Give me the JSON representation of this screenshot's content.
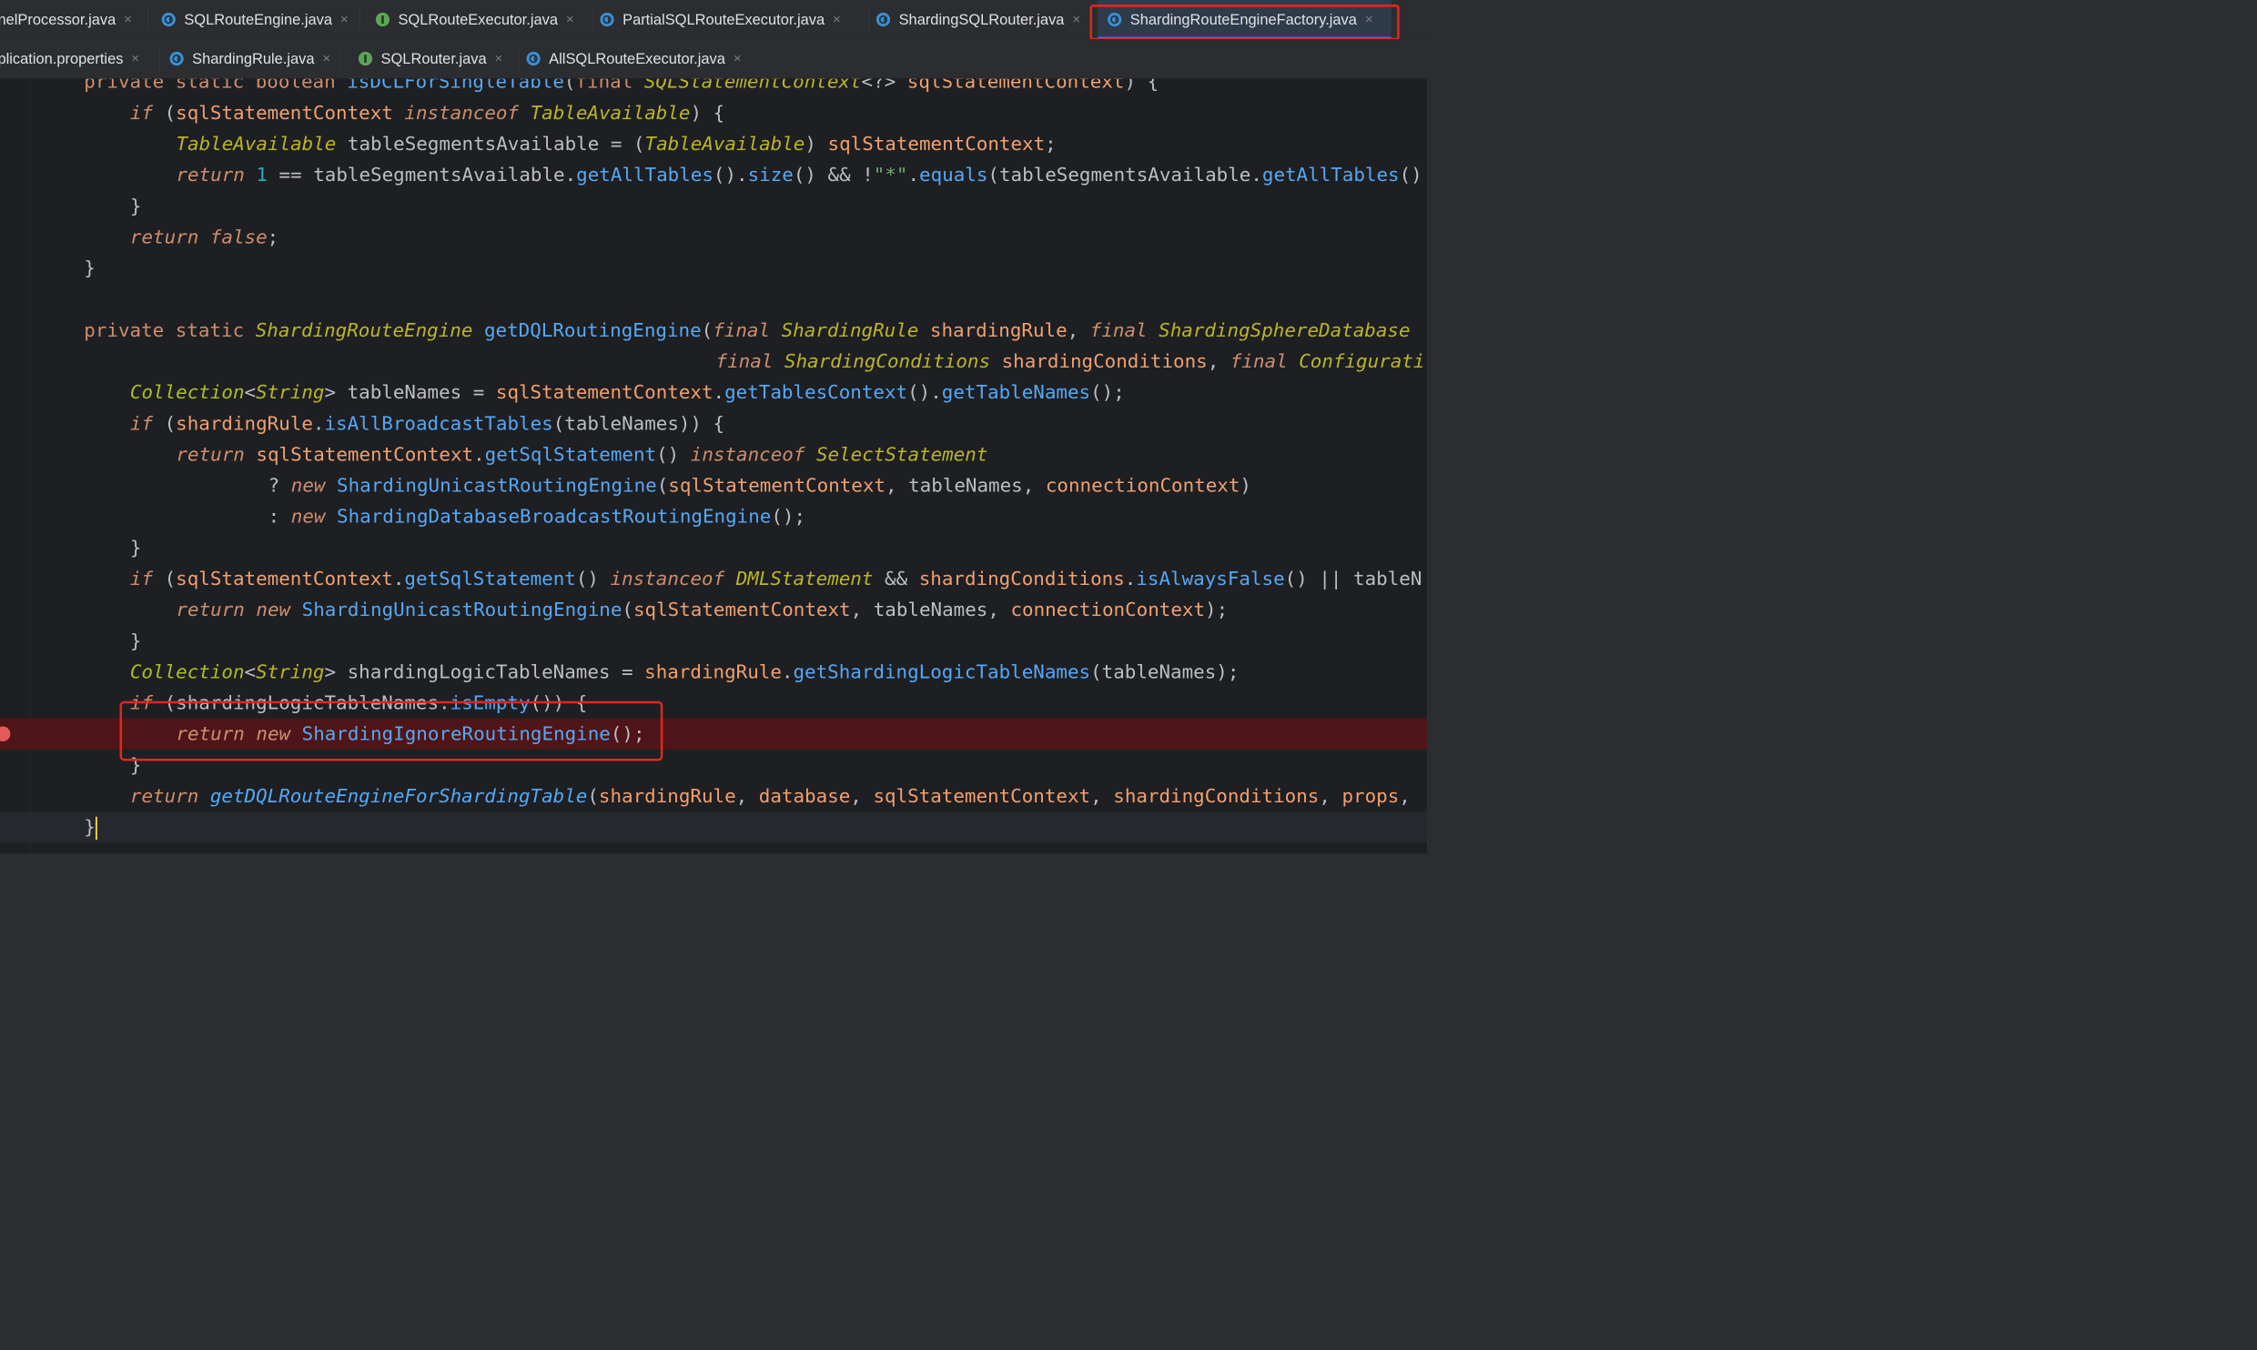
{
  "tabs_row1": [
    {
      "label": "nelProcessor.java",
      "icon": "class-icon",
      "active": false
    },
    {
      "label": "SQLRouteEngine.java",
      "icon": "class-icon",
      "active": false
    },
    {
      "label": "SQLRouteExecutor.java",
      "icon": "interface-icon",
      "active": false
    },
    {
      "label": "PartialSQLRouteExecutor.java",
      "icon": "class-icon",
      "active": false
    },
    {
      "label": "ShardingSQLRouter.java",
      "icon": "class-icon",
      "active": false
    },
    {
      "label": "ShardingRouteEngineFactory.java",
      "icon": "class-icon",
      "active": true
    }
  ],
  "tabs_row2": [
    {
      "label": "plication.properties",
      "icon": "properties-icon",
      "active": false
    },
    {
      "label": "ShardingRule.java",
      "icon": "class-icon",
      "active": false
    },
    {
      "label": "SQLRouter.java",
      "icon": "interface-icon",
      "active": false
    },
    {
      "label": "AllSQLRouteExecutor.java",
      "icon": "class-icon",
      "active": false
    }
  ],
  "close_glyph": "×",
  "annotation_color": "#e5251d",
  "breakpoint_color": "#e35a5a",
  "code": {
    "l0": "private static boolean isDCLForSingleTable(final SQLStatementContext<?> sqlStatementContext) {",
    "l1": "if (sqlStatementContext instanceof TableAvailable) {",
    "l2": "TableAvailable tableSegmentsAvailable = (TableAvailable) sqlStatementContext;",
    "l3": "return 1 == tableSegmentsAvailable.getAllTables().size() && !\"*\".equals(tableSegmentsAvailable.getAllTables()",
    "l4": "}",
    "l5": "return false;",
    "l6": "}",
    "l8": "private static ShardingRouteEngine getDQLRoutingEngine(final ShardingRule shardingRule, final ShardingSphereDatabase",
    "l9": "final ShardingConditions shardingConditions, final Configurati",
    "l10": "Collection<String> tableNames = sqlStatementContext.getTablesContext().getTableNames();",
    "l11": "if (shardingRule.isAllBroadcastTables(tableNames)) {",
    "l12": "return sqlStatementContext.getSqlStatement() instanceof SelectStatement",
    "l13": "? new ShardingUnicastRoutingEngine(sqlStatementContext, tableNames, connectionContext)",
    "l14": ": new ShardingDatabaseBroadcastRoutingEngine();",
    "l15": "}",
    "l16": "if (sqlStatementContext.getSqlStatement() instanceof DMLStatement && shardingConditions.isAlwaysFalse() || tableN",
    "l17": "return new ShardingUnicastRoutingEngine(sqlStatementContext, tableNames, connectionContext);",
    "l18": "}",
    "l19": "Collection<String> shardingLogicTableNames = shardingRule.getShardingLogicTableNames(tableNames);",
    "l20": "if (shardingLogicTableNames.isEmpty()) {",
    "l21": "return new ShardingIgnoreRoutingEngine();",
    "l22": "}",
    "l23": "return getDQLRouteEngineForShardingTable(shardingRule, database, sqlStatementContext, shardingConditions, props,",
    "l24": "}"
  }
}
